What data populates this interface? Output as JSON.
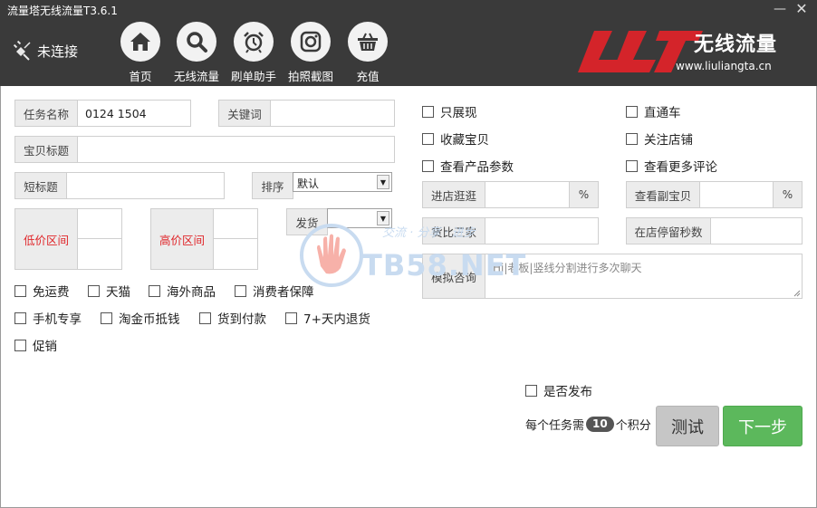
{
  "window": {
    "title": "流量塔无线流量T3.6.1",
    "minimize": "—",
    "close": "✕"
  },
  "status": {
    "text": "未连接"
  },
  "nav": [
    {
      "label": "首页",
      "icon": "home-icon"
    },
    {
      "label": "无线流量",
      "icon": "search-icon"
    },
    {
      "label": "刷单助手",
      "icon": "alarm-clock-icon"
    },
    {
      "label": "拍照截图",
      "icon": "camera-icon"
    },
    {
      "label": "充值",
      "icon": "basket-icon"
    }
  ],
  "logo": {
    "mark": "LLT",
    "name": "无线流量",
    "url": "www.liuliangta.cn"
  },
  "form": {
    "task_name_label": "任务名称",
    "task_name_value": "0124 1504",
    "keyword_label": "关键词",
    "keyword_value": "",
    "product_title_label": "宝贝标题",
    "product_title_value": "",
    "short_title_label": "短标题",
    "short_title_value": "",
    "sort_label": "排序",
    "sort_value": "默认",
    "low_price_label": "低价区间",
    "high_price_label": "高价区间",
    "ship_label": "发货",
    "ship_value": ""
  },
  "filters": {
    "row1": [
      "免运费",
      "天猫",
      "海外商品",
      "消费者保障"
    ],
    "row2": [
      "手机专享",
      "淘金币抵钱",
      "货到付款",
      "7+天内退货"
    ],
    "row3": [
      "促销"
    ]
  },
  "options": {
    "left": [
      "只展现",
      "收藏宝贝",
      "查看产品参数"
    ],
    "right": [
      "直通车",
      "关注店铺",
      "查看更多评论"
    ]
  },
  "stats": {
    "browse_label": "进店逛逛",
    "view_sub_label": "查看副宝贝",
    "percent": "%",
    "compare_label": "货比三家",
    "stay_label": "在店停留秒数",
    "chat_label": "模拟咨询",
    "chat_placeholder": "Hi|老板|竖线分割进行多次聊天"
  },
  "watermark": {
    "text": "TB58.NET",
    "slogan": "交流 · 分享 · 进步"
  },
  "footer": {
    "publish_label": "是否发布",
    "points_prefix": "每个任务需",
    "points_value": "10",
    "points_suffix": "个积分",
    "test_button": "测试",
    "next_button": "下一步"
  },
  "colors": {
    "topbar": "#3a3a3a",
    "accent_red": "#e0262a",
    "next_green": "#5cb85c"
  }
}
